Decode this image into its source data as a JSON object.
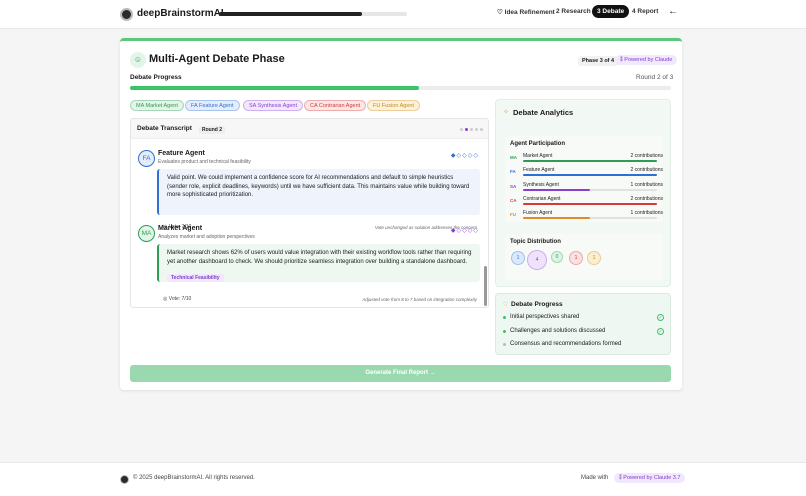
{
  "app": {
    "brand": "deepBrainstormAI",
    "progress_fraction": 0.76,
    "back_icon": "arrow-left-icon"
  },
  "nav": [
    {
      "label": "Idea Refinement",
      "icon": "lightbulb-icon"
    },
    {
      "label": "2 Research"
    },
    {
      "label": "3 Debate",
      "active": true
    },
    {
      "label": "4 Report"
    }
  ],
  "phase": {
    "title": "Multi-Agent Debate Phase",
    "icon": "users-icon",
    "step": "Phase 3 of 4",
    "powered": "Powered by Claude",
    "progress_label": "Debate Progress",
    "round": "Round 2 of 3",
    "progress_fraction": 0.535
  },
  "agents": [
    {
      "abbr": "MA",
      "name": "Market Agent",
      "color": "#2e9c55",
      "bg": "#e3f4e8"
    },
    {
      "abbr": "FA",
      "name": "Feature Agent",
      "color": "#2f6fd1",
      "bg": "#e4edfb"
    },
    {
      "abbr": "SA",
      "name": "Synthesis Agent",
      "color": "#8a3fd1",
      "bg": "#f2e8fd"
    },
    {
      "abbr": "CA",
      "name": "Contrarian Agent",
      "color": "#d13b3b",
      "bg": "#fce6e6"
    },
    {
      "abbr": "FU",
      "name": "Fusion Agent",
      "color": "#c98a17",
      "bg": "#fcf1da"
    }
  ],
  "transcript": {
    "title": "Debate Transcript",
    "round": "Round 2",
    "messages": [
      {
        "abbr": "FA",
        "name": "Feature Agent",
        "role": "Evaluates product and technical feasibility",
        "text": "Valid point. We could implement a confidence score for AI recommendations and default to simple heuristics (sender role, explicit deadlines, keywords) until we have sufficient data. This maintains value while building toward more sophisticated prioritization.",
        "vote": "Vote: 7/10",
        "note": "Vote unchanged as solution addresses the concern",
        "rating": "◆◇◇◇◇",
        "color": "#2f6fd1",
        "bg": "#eef3fc",
        "icon": "vote-icon"
      },
      {
        "abbr": "MA",
        "name": "Market Agent",
        "role": "Analyzes market and adoption perspectives",
        "text": "Market research shows 62% of users would value integration with their existing workflow tools rather than requiring yet another dashboard to check. We should prioritize seamless integration over building a standalone dashboard.",
        "tag": "Technical Feasibility",
        "vote": "Vote: 7/10",
        "note": "Adjusted vote from 8 to 7 based on integration complexity",
        "rating": "◆◇◇◇◇",
        "color": "#2e9c55",
        "bg": "#eef8f1",
        "icon": "vote-icon"
      }
    ]
  },
  "analytics": {
    "title": "Debate Analytics",
    "icon": "sparkle-icon",
    "participation_title": "Agent Participation",
    "participation": [
      {
        "abbr": "MA",
        "name": "Market Agent",
        "count": "2 contributions",
        "fraction": 1.0,
        "color": "#2e9c55"
      },
      {
        "abbr": "FA",
        "name": "Feature Agent",
        "count": "2 contributions",
        "fraction": 1.0,
        "color": "#2f6fd1"
      },
      {
        "abbr": "SA",
        "name": "Synthesis Agent",
        "count": "1 contributions",
        "fraction": 0.5,
        "color": "#8a3fd1"
      },
      {
        "abbr": "CA",
        "name": "Contrarian Agent",
        "count": "2 contributions",
        "fraction": 1.0,
        "color": "#d13b3b"
      },
      {
        "abbr": "FU",
        "name": "Fusion Agent",
        "count": "1 contributions",
        "fraction": 0.5,
        "color": "#e08a2a"
      }
    ],
    "topic_title": "Topic Distribution",
    "topics": [
      {
        "value": "1",
        "color": "#2f6fd1",
        "bg": "#dce8fb"
      },
      {
        "value": "4",
        "color": "#8a3fd1",
        "bg": "#eee3fb"
      },
      {
        "value": "0",
        "color": "#2e9c55",
        "bg": "#dff3e5"
      },
      {
        "value": "1",
        "color": "#d13b3b",
        "bg": "#fbe1e1"
      },
      {
        "value": "1",
        "color": "#c98a17",
        "bg": "#fbefd3"
      }
    ]
  },
  "progress_panel": {
    "title": "Debate Progress",
    "icon": "lightbulb-icon",
    "items": [
      {
        "label": "Initial perspectives shared",
        "done": true
      },
      {
        "label": "Challenges and solutions discussed",
        "done": true
      },
      {
        "label": "Consensus and recommendations formed",
        "done": false
      }
    ]
  },
  "generate_button": "Generate Final Report",
  "footer": {
    "copyright": "© 2025 deepBrainstormAI. All rights reserved.",
    "made_with": "Made with",
    "powered": "Powered by Claude 3.7"
  },
  "colors": {
    "accent": "#3cc36a"
  }
}
